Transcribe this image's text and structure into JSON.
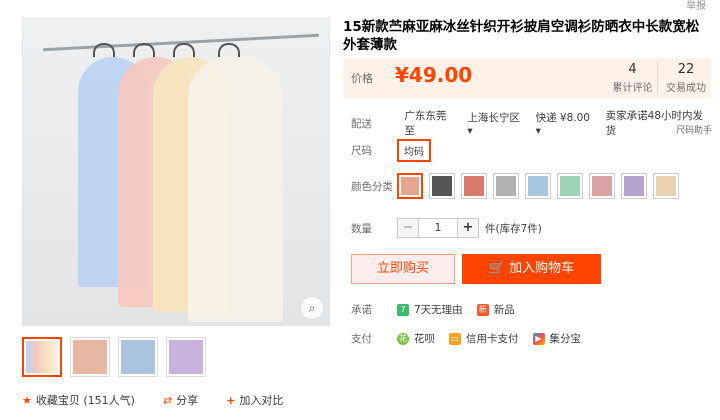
{
  "header": {
    "report": "举报"
  },
  "product": {
    "title": "15新款苎麻亚麻冰丝针织开衫披肩空调衫防晒衣中长款宽松外套薄款",
    "price_label": "价格",
    "price": "¥49.00",
    "reviews_count": "4",
    "reviews_label": "累计评论",
    "sales_count": "22",
    "sales_label": "交易成功"
  },
  "shipping": {
    "label": "配送",
    "from": "广东东莞 至",
    "to": "上海长宁区 ▾",
    "method": "快递 ¥8.00 ▾",
    "promise": "卖家承诺48小时内发货",
    "helper": "尺码助手"
  },
  "size": {
    "label": "尺码",
    "option": "均码"
  },
  "color": {
    "label": "颜色分类",
    "swatches": [
      "#e8a58e",
      "#555555",
      "#d97a6e",
      "#b2b2b2",
      "#a8c8e0",
      "#9fd3b8",
      "#d9a3a3",
      "#b7a3cf",
      "#e9d3b0"
    ]
  },
  "quantity": {
    "label": "数量",
    "minus": "−",
    "value": "1",
    "plus": "+",
    "stock": "件(库存7件)"
  },
  "actions": {
    "buy_now": "立即购买",
    "add_cart": "加入购物车"
  },
  "promise": {
    "label": "承诺",
    "item1": "7天无理由",
    "item2": "新品"
  },
  "payment": {
    "label": "支付",
    "item1": "花呗",
    "item2": "信用卡支付",
    "item3": "集分宝"
  },
  "social": {
    "favorite": "收藏宝贝 (151人气)",
    "share": "分享",
    "compare": "加入对比"
  },
  "gallery": {
    "thumbs": [
      "#e8ded3",
      "#e8b7a1",
      "#a9c3e0",
      "#c8b2e0"
    ]
  }
}
